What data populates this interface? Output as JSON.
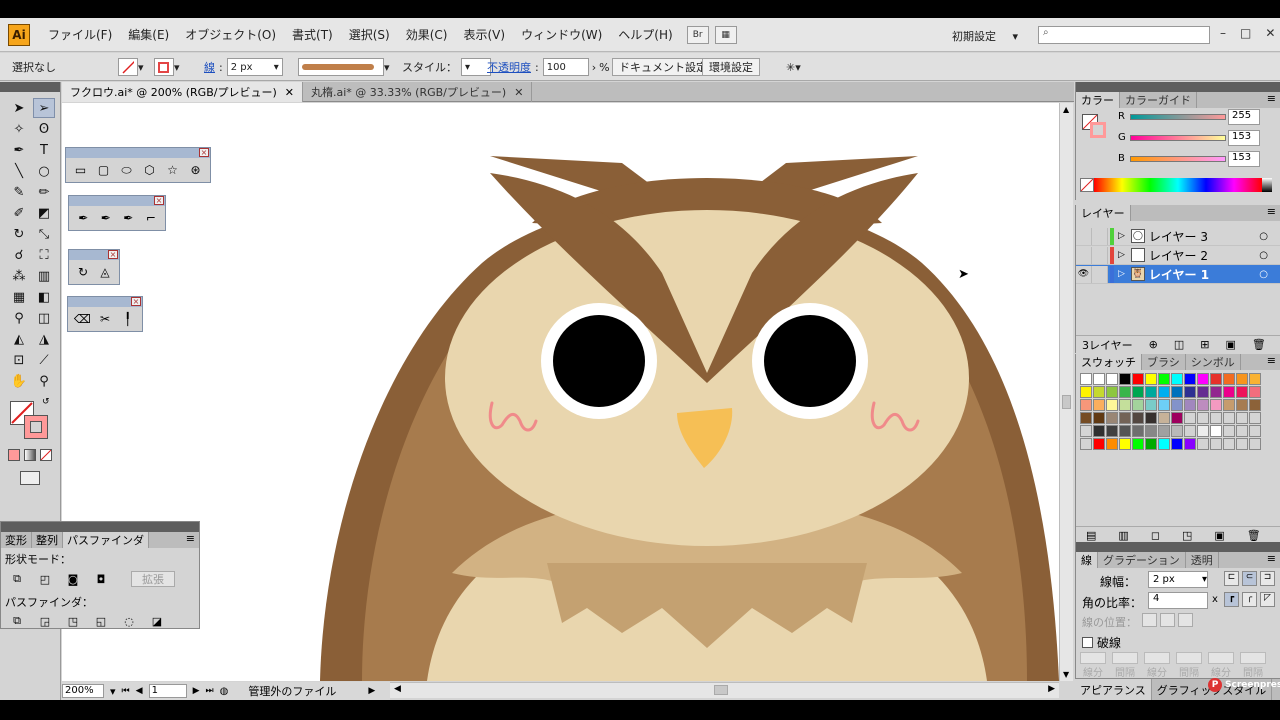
{
  "menu": {
    "logo": "Ai",
    "items": [
      "ファイル(F)",
      "編集(E)",
      "オブジェクト(O)",
      "書式(T)",
      "選択(S)",
      "効果(C)",
      "表示(V)",
      "ウィンドウ(W)",
      "ヘルプ(H)"
    ],
    "bridge_icon": "Br",
    "workspace": "初期設定",
    "win_min": "–",
    "win_max": "□",
    "win_close": "✕"
  },
  "control": {
    "selection": "選択なし",
    "stroke_label": "線",
    "stroke_value": "2 px",
    "style_label": "スタイル：",
    "opacity_label": "不透明度",
    "opacity_value": "100",
    "opacity_unit": "%",
    "doc_settings": "ドキュメント設定",
    "env_settings": "環境設定"
  },
  "tabs": [
    {
      "label": "フクロウ.ai* @ 200% (RGB/プレビュー)",
      "close": "✕"
    },
    {
      "label": "丸楕.ai* @ 33.33% (RGB/プレビュー)",
      "close": "✕"
    }
  ],
  "status": {
    "zoom": "200%",
    "page": "1",
    "info": "管理外のファイル"
  },
  "pathfinder": {
    "tabs": [
      "変形",
      "整列",
      "パスファインダ"
    ],
    "shape_mode": "形状モード：",
    "expand": "拡張",
    "pathfinder_label": "パスファインダ："
  },
  "color_panel": {
    "tabs": [
      "カラー",
      "カラーガイド"
    ],
    "r_label": "R",
    "r_value": "255",
    "g_label": "G",
    "g_value": "153",
    "b_label": "B",
    "b_value": "153",
    "stroke_color": "#ff9999"
  },
  "layers_panel": {
    "tabs": [
      "レイヤー"
    ],
    "layers": [
      {
        "name": "レイヤー 3",
        "color": "#4fd13a"
      },
      {
        "name": "レイヤー 2",
        "color": "#e2453b"
      },
      {
        "name": "レイヤー 1",
        "color": "#3b6fd9"
      }
    ],
    "count": "3レイヤー"
  },
  "swatches_panel": {
    "tabs": [
      "スウォッチ",
      "ブラシ",
      "シンボル"
    ]
  },
  "stroke_panel": {
    "tabs": [
      "線",
      "グラデーション",
      "透明"
    ],
    "weight_label": "線幅：",
    "weight_value": "2 px",
    "miter_label": "角の比率：",
    "miter_value": "4",
    "miter_unit": "x",
    "align_label": "線の位置：",
    "dashed_label": "破線",
    "dash_labels": [
      "線分",
      "間隔",
      "線分",
      "間隔",
      "線分",
      "間隔"
    ]
  },
  "bottom_tabs": [
    "アピアランス",
    "グラフィックスタイル"
  ],
  "watermark": "Screenpresso"
}
